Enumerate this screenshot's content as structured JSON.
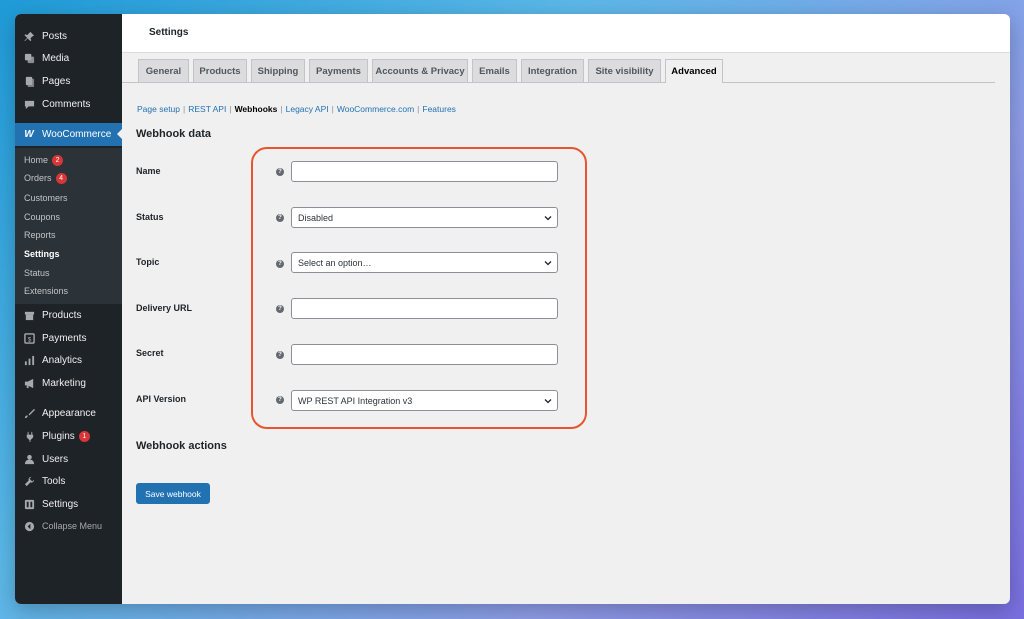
{
  "sidebar": {
    "top_items": [
      {
        "label": "Posts",
        "icon": "pin-icon"
      },
      {
        "label": "Media",
        "icon": "media-icon"
      },
      {
        "label": "Pages",
        "icon": "pages-icon"
      },
      {
        "label": "Comments",
        "icon": "comment-icon"
      }
    ],
    "woocommerce": {
      "label": "WooCommerce",
      "icon": "woo-icon"
    },
    "submenu": [
      {
        "label": "Home",
        "badge": "2"
      },
      {
        "label": "Orders",
        "badge": "4"
      },
      {
        "label": "Customers"
      },
      {
        "label": "Coupons"
      },
      {
        "label": "Reports"
      },
      {
        "label": "Settings",
        "current": true
      },
      {
        "label": "Status"
      },
      {
        "label": "Extensions"
      }
    ],
    "bottom_items": [
      {
        "label": "Products",
        "icon": "archive-icon"
      },
      {
        "label": "Payments",
        "icon": "payments-icon"
      },
      {
        "label": "Analytics",
        "icon": "chart-bar-icon"
      },
      {
        "label": "Marketing",
        "icon": "megaphone-icon"
      },
      {
        "label": "Appearance",
        "icon": "brush-icon"
      },
      {
        "label": "Plugins",
        "icon": "plug-icon",
        "badge": "1"
      },
      {
        "label": "Users",
        "icon": "user-icon"
      },
      {
        "label": "Tools",
        "icon": "wrench-icon"
      },
      {
        "label": "Settings",
        "icon": "settings-icon"
      }
    ],
    "collapse_label": "Collapse Menu"
  },
  "header": {
    "title": "Settings"
  },
  "tabs": [
    {
      "label": "General"
    },
    {
      "label": "Products"
    },
    {
      "label": "Shipping"
    },
    {
      "label": "Payments"
    },
    {
      "label": "Accounts & Privacy"
    },
    {
      "label": "Emails"
    },
    {
      "label": "Integration"
    },
    {
      "label": "Site visibility"
    },
    {
      "label": "Advanced",
      "active": true
    }
  ],
  "subsections": [
    {
      "label": "Page setup"
    },
    {
      "label": "REST API"
    },
    {
      "label": "Webhooks",
      "current": true
    },
    {
      "label": "Legacy API"
    },
    {
      "label": "WooCommerce.com"
    },
    {
      "label": "Features"
    }
  ],
  "webhook_data": {
    "heading": "Webhook data",
    "fields": [
      {
        "label": "Name",
        "type": "text",
        "value": ""
      },
      {
        "label": "Status",
        "type": "select",
        "value": "Disabled"
      },
      {
        "label": "Topic",
        "type": "select",
        "value": "Select an option…"
      },
      {
        "label": "Delivery URL",
        "type": "text",
        "value": ""
      },
      {
        "label": "Secret",
        "type": "text",
        "value": ""
      },
      {
        "label": "API Version",
        "type": "select",
        "value": "WP REST API Integration v3"
      }
    ],
    "help_glyph": "?"
  },
  "webhook_actions": {
    "heading": "Webhook actions"
  },
  "save_button": {
    "label": "Save webhook"
  },
  "colors": {
    "sidebar_bg": "#1d2327",
    "accent": "#2271b1",
    "highlight": "#e8542c",
    "badge": "#d63638"
  }
}
